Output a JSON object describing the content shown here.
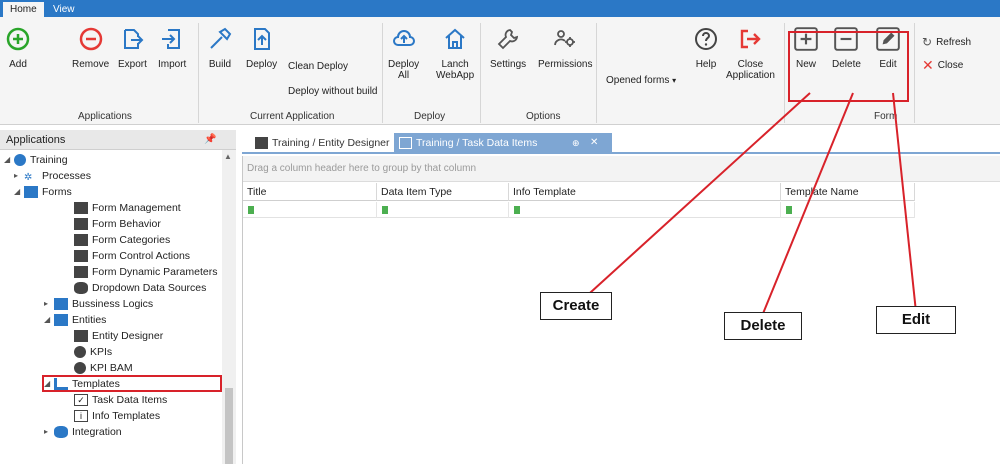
{
  "ribbon_tabs": [
    "Home",
    "View"
  ],
  "ribbon": {
    "buttons": {
      "add": "Add",
      "remove": "Remove",
      "export": "Export",
      "import": "Import",
      "build": "Build",
      "deploy": "Deploy",
      "clean_deploy": "Clean Deploy",
      "deploy_without_build": "Deploy without build",
      "deploy_all_1": "Deploy",
      "deploy_all_2": "All",
      "launch_1": "Lanch",
      "launch_2": "WebApp",
      "settings": "Settings",
      "permissions": "Permissions",
      "opened_forms": "Opened forms",
      "help": "Help",
      "close_app_1": "Close",
      "close_app_2": "Application",
      "new": "New",
      "delete": "Delete",
      "edit": "Edit",
      "refresh": "Refresh",
      "close": "Close"
    },
    "groups": {
      "applications": "Applications",
      "current_application": "Current Application",
      "deploy": "Deploy",
      "options": "Options",
      "form": "Form"
    }
  },
  "left_panel": {
    "title": "Applications",
    "items": [
      {
        "label": "Training"
      },
      {
        "label": "Processes"
      },
      {
        "label": "Forms"
      },
      {
        "label": "Form Management"
      },
      {
        "label": "Form Behavior"
      },
      {
        "label": "Form Categories"
      },
      {
        "label": "Form Control Actions"
      },
      {
        "label": "Form Dynamic Parameters"
      },
      {
        "label": "Dropdown Data Sources"
      },
      {
        "label": "Bussiness Logics"
      },
      {
        "label": "Entities"
      },
      {
        "label": "Entity Designer"
      },
      {
        "label": "KPIs"
      },
      {
        "label": "KPI BAM"
      },
      {
        "label": "Templates"
      },
      {
        "label": "Task Data Items"
      },
      {
        "label": "Info Templates"
      },
      {
        "label": "Integration"
      }
    ]
  },
  "doc_tabs": [
    "Training / Entity Designer",
    "Training / Task Data Items"
  ],
  "grid": {
    "group_hint": "Drag a column header here to group by that column",
    "columns": [
      "Title",
      "Data Item Type",
      "Info Template",
      "Template Name"
    ]
  },
  "annotations": {
    "create": "Create",
    "delete": "Delete",
    "edit": "Edit"
  },
  "colors": {
    "accent_blue": "#2b78c6",
    "annotation_red": "#d8222a",
    "add_green": "#2aa52a",
    "remove_red": "#e53935"
  }
}
